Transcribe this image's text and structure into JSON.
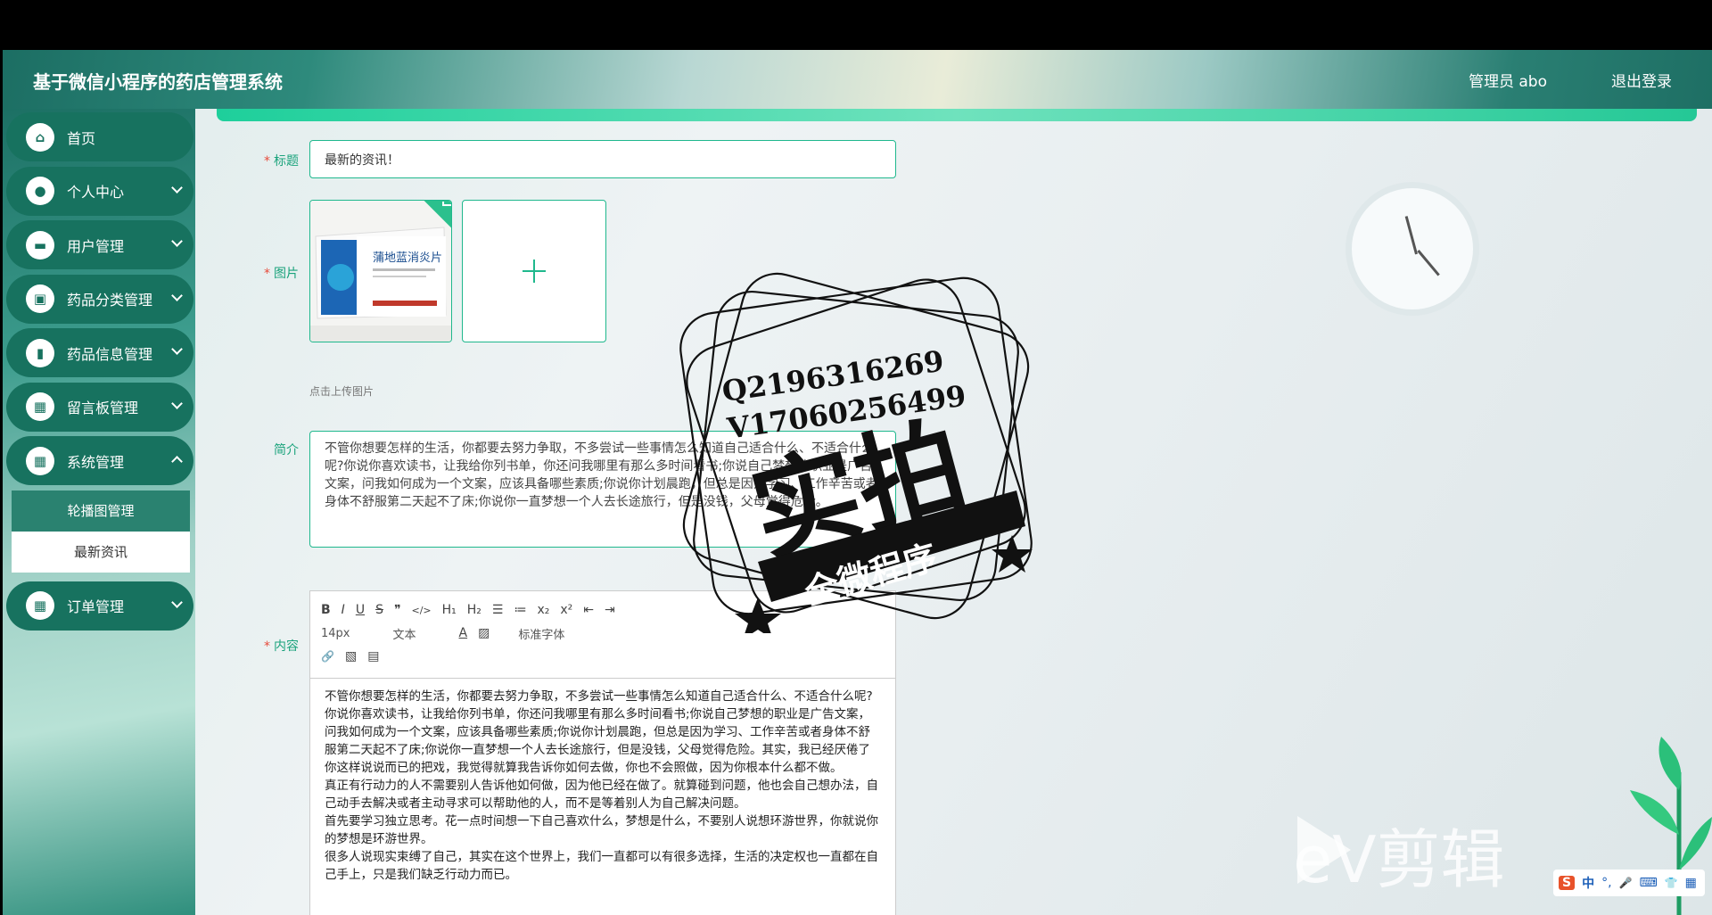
{
  "app": {
    "title": "基于微信小程序的药店管理系统",
    "admin": "管理员 abo",
    "logout": "退出登录"
  },
  "sidebar": {
    "items": [
      {
        "label": "首页",
        "icon": "home-icon",
        "glyph": "⌂"
      },
      {
        "label": "个人中心",
        "icon": "user-icon",
        "glyph": "●"
      },
      {
        "label": "用户管理",
        "icon": "users-icon",
        "glyph": "▬"
      },
      {
        "label": "药品分类管理",
        "icon": "category-icon",
        "glyph": "▣"
      },
      {
        "label": "药品信息管理",
        "icon": "chart-icon",
        "glyph": "▮"
      },
      {
        "label": "留言板管理",
        "icon": "grid-icon",
        "glyph": "▦"
      },
      {
        "label": "系统管理",
        "icon": "grid-icon",
        "glyph": "▦"
      }
    ],
    "sub": [
      "轮播图管理",
      "最新资讯"
    ],
    "last": {
      "label": "订单管理",
      "icon": "grid-icon",
      "glyph": "▦"
    }
  },
  "form": {
    "title_label": "标题",
    "title_value": "最新的资讯！",
    "image_label": "图片",
    "image_alt": "蒲地蓝消炎片",
    "upload_hint": "点击上传图片",
    "intro_label": "简介",
    "intro_text": "不管你想要怎样的生活，你都要去努力争取，不多尝试一些事情怎么知道自己适合什么、不适合什么呢?你说你喜欢读书，让我给你列书单，你还问我哪里有那么多时间看书;你说自己梦想的职业是广告文案，问我如何成为一个文案，应该具备哪些素质;你说你计划晨跑，但总是因为学习、工作辛苦或者身体不舒服第二天起不了床;你说你一直梦想一个人去长途旅行，但是没钱，父母觉得危险。",
    "content_label": "内容",
    "toolbar": {
      "row1": [
        "B",
        "I",
        "U",
        "S",
        "❞",
        "</>",
        "H₁",
        "H₂",
        "☰",
        "≔",
        "x₂",
        "x²",
        "⇤",
        "⇥"
      ],
      "font_size": "14px",
      "block": "文本",
      "font_family": "标准字体",
      "row2_icons": [
        "A",
        "▨"
      ],
      "row3": [
        "🔗",
        "▧",
        "▤"
      ]
    },
    "content_paragraphs": [
      "不管你想要怎样的生活，你都要去努力争取，不多尝试一些事情怎么知道自己适合什么、不适合什么呢?",
      "你说你喜欢读书，让我给你列书单，你还问我哪里有那么多时间看书;你说自己梦想的职业是广告文案，问我如何成为一个文案，应该具备哪些素质;你说你计划晨跑，但总是因为学习、工作辛苦或者身体不舒服第二天起不了床;你说你一直梦想一个人去长途旅行，但是没钱，父母觉得危险。其实，我已经厌倦了你这样说说而已的把戏，我觉得就算我告诉你如何去做，你也不会照做，因为你根本什么都不做。",
      "真正有行动力的人不需要别人告诉他如何做，因为他已经在做了。就算碰到问题，他也会自己想办法，自己动手去解决或者主动寻求可以帮助他的人，而不是等着别人为自己解决问题。",
      "首先要学习独立思考。花一点时间想一下自己喜欢什么，梦想是什么，不要别人说想环游世界，你就说你的梦想是环游世界。",
      "很多人说现实束缚了自己，其实在这个世界上，我们一直都可以有很多选择，生活的决定权也一直都在自己手上，只是我们缺乏行动力而已。"
    ]
  },
  "stamp": {
    "qq": "Q2196316269",
    "v": "V17060256499",
    "big": "实拍",
    "banner": "全微程序"
  },
  "watermark": {
    "text": "eV剪辑"
  },
  "ime": {
    "items": [
      "S",
      "中",
      "°,",
      "🎤",
      "⌨",
      "👕",
      "▦"
    ]
  }
}
